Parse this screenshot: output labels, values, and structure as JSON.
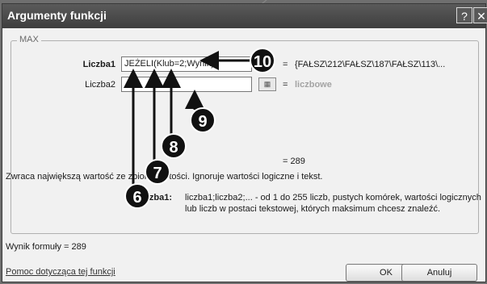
{
  "window": {
    "title": "Argumenty funkcji",
    "help_label": "?",
    "close_label": "✕"
  },
  "function_group": {
    "name": "MAX"
  },
  "args": [
    {
      "label": "Liczba1",
      "value": "JEŻELI(Klub=2;Wynik)",
      "eq": "=",
      "result": "{FAŁSZ\\212\\FAŁSZ\\187\\FAŁSZ\\113\\..."
    },
    {
      "label": "Liczba2",
      "value": "",
      "eq": "=",
      "result": "liczbowe"
    }
  ],
  "overall_result": "=  289",
  "description": "Zwraca największą wartość ze zbioru wartości. Ignoruje wartości logiczne i tekst.",
  "arg_help": {
    "label": "Liczba1:",
    "text_line1": "liczba1;liczba2;... - od 1 do 255 liczb, pustych komórek, wartości logicznych",
    "text_line2": "lub liczb w postaci tekstowej, których maksimum chcesz znaleźć."
  },
  "formula_result": "Wynik formuły =   289",
  "help_link": "Pomoc dotycząca tej funkcji",
  "buttons": {
    "ok": "OK",
    "cancel": "Anuluj"
  },
  "callouts": [
    "6",
    "7",
    "8",
    "9",
    "10"
  ],
  "colors": {
    "titlebar": "#4a4a4a",
    "dialog_bg": "#f1f1f1",
    "callout_bg": "#111111"
  }
}
